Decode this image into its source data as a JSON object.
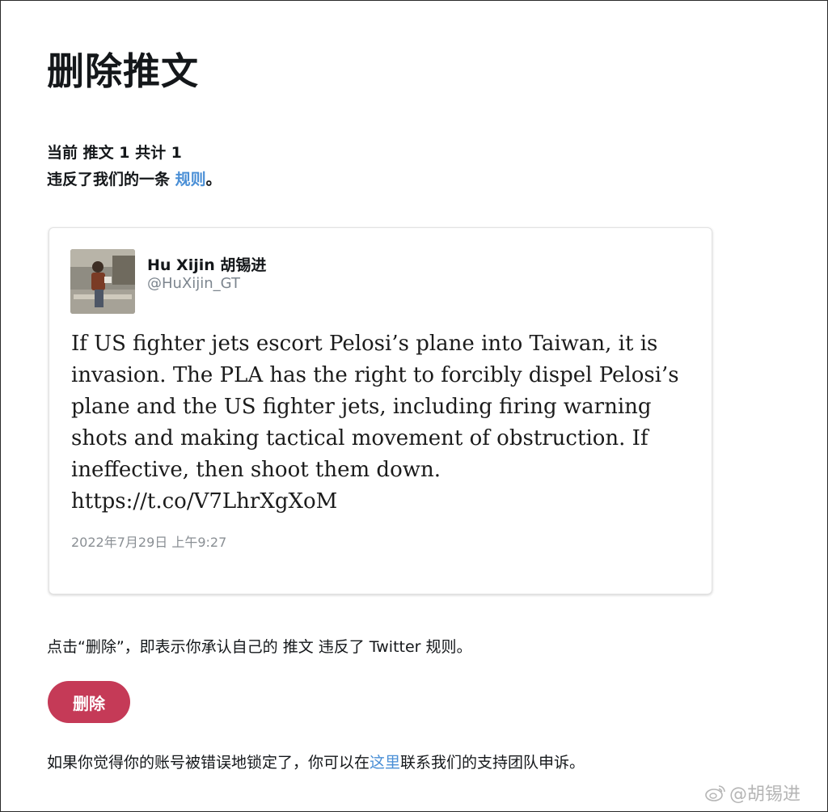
{
  "page": {
    "title": "删除推文",
    "summary_line1": "当前 推文 1 共计 1",
    "summary_line2_prefix": "违反了我们的一条 ",
    "rules_link": "规则",
    "summary_line2_suffix": "。"
  },
  "tweet": {
    "display_name": "Hu Xijin 胡锡进",
    "handle": "@HuXijin_GT",
    "text": "If US fighter jets escort Pelosi’s plane into Taiwan, it is\ninvasion. The PLA has the right to forcibly dispel Pelosi’s\nplane and the US fighter jets, including firing warning\nshots and making tactical movement of obstruction. If\nineffective, then shoot them down.\nhttps://t.co/V7LhrXgXoM",
    "timestamp": "2022年7月29日 上午9:27"
  },
  "confirm": {
    "text": "点击“删除”，即表示你承认自己的 推文 违反了 Twitter 规则。"
  },
  "actions": {
    "delete_label": "删除"
  },
  "appeal": {
    "prefix": "如果你觉得你的账号被错误地锁定了，你可以在",
    "link": "这里",
    "suffix": "联系我们的支持团队申诉。"
  },
  "watermark": {
    "text": "@胡锡进",
    "icon": "weibo-icon"
  },
  "colors": {
    "link": "#4a8fd6",
    "delete_button": "#c53a57",
    "muted_text": "#7c858e"
  }
}
